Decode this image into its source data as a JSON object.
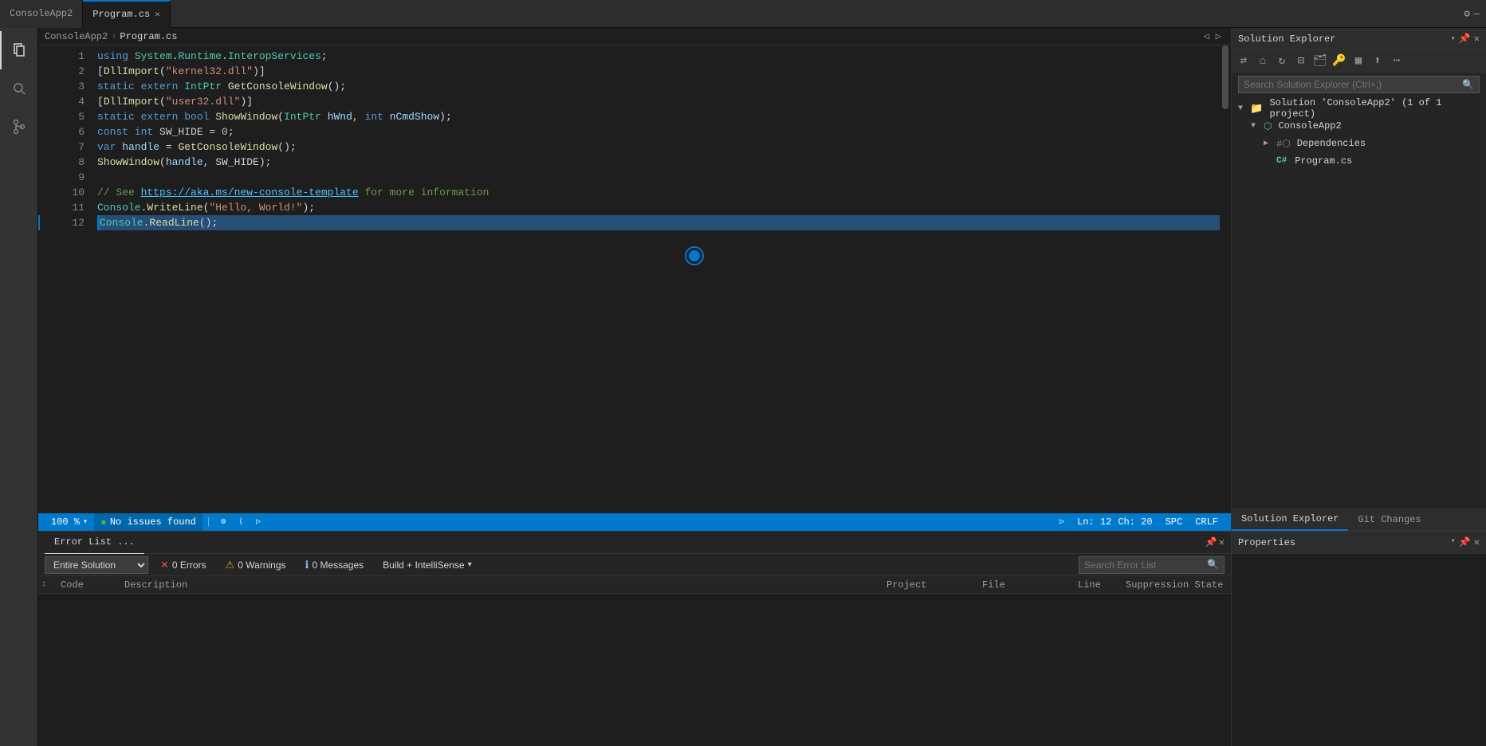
{
  "tabs": [
    {
      "label": "ConsoleApp2",
      "active": false,
      "closable": false
    },
    {
      "label": "Program.cs",
      "active": true,
      "closable": true
    }
  ],
  "breadcrumb": {
    "project": "ConsoleApp2",
    "file": "Program.cs"
  },
  "editor": {
    "lines": [
      {
        "num": 1,
        "content": "using System.Runtime.InteropServices;"
      },
      {
        "num": 2,
        "content": "[DllImport(\"kernel32.dll\")]"
      },
      {
        "num": 3,
        "content": "static extern IntPtr GetConsoleWindow();"
      },
      {
        "num": 4,
        "content": "[DllImport(\"user32.dll\")]"
      },
      {
        "num": 5,
        "content": "static extern bool ShowWindow(IntPtr hWnd, int nCmdShow);"
      },
      {
        "num": 6,
        "content": "const int SW_HIDE = 0;"
      },
      {
        "num": 7,
        "content": "var handle = GetConsoleWindow();"
      },
      {
        "num": 8,
        "content": "ShowWindow(handle, SW_HIDE);"
      },
      {
        "num": 9,
        "content": ""
      },
      {
        "num": 10,
        "content": "// See https://aka.ms/new-console-template for more information"
      },
      {
        "num": 11,
        "content": "Console.WriteLine(\"Hello, World!\");"
      },
      {
        "num": 12,
        "content": "Console.ReadLine();",
        "highlighted": true
      }
    ]
  },
  "statusBar": {
    "zoom": "100 %",
    "noIssues": "No issues found",
    "lineCol": "Ln: 12",
    "ch": "Ch: 20",
    "encoding": "SPC",
    "lineEnding": "CRLF"
  },
  "bottomPanel": {
    "title": "Error List ...",
    "filter": "Entire Solution",
    "errors": {
      "label": "0 Errors",
      "count": 0
    },
    "warnings": {
      "label": "0 Warnings",
      "count": 0
    },
    "messages": {
      "label": "0 Messages",
      "count": 0
    },
    "buildFilter": "Build + IntelliSense",
    "searchPlaceholder": "Search Error List",
    "columns": [
      "Code",
      "Description",
      "Project",
      "File",
      "Line",
      "Suppression State"
    ]
  },
  "solutionExplorer": {
    "title": "Solution Explorer",
    "searchPlaceholder": "Search Solution Explorer (Ctrl+;)",
    "tree": [
      {
        "label": "Solution 'ConsoleApp2' (1 of 1 project)",
        "icon": "📄",
        "indent": 0,
        "expanded": true
      },
      {
        "label": "ConsoleApp2",
        "icon": "🔷",
        "indent": 1,
        "expanded": true
      },
      {
        "label": "Dependencies",
        "icon": "🔗",
        "indent": 2,
        "expanded": false
      },
      {
        "label": "Program.cs",
        "icon": "C#",
        "indent": 2,
        "expanded": false
      }
    ],
    "tabs": [
      "Solution Explorer",
      "Git Changes"
    ]
  },
  "properties": {
    "title": "Properties"
  },
  "icons": {
    "chevron_right": "▶",
    "chevron_down": "▼",
    "close": "✕",
    "search": "🔍",
    "settings": "⚙",
    "pin": "📌",
    "unpin": "📌",
    "error": "🔴",
    "warning": "⚠",
    "message": "ℹ",
    "check": "✓",
    "dot": "●"
  }
}
